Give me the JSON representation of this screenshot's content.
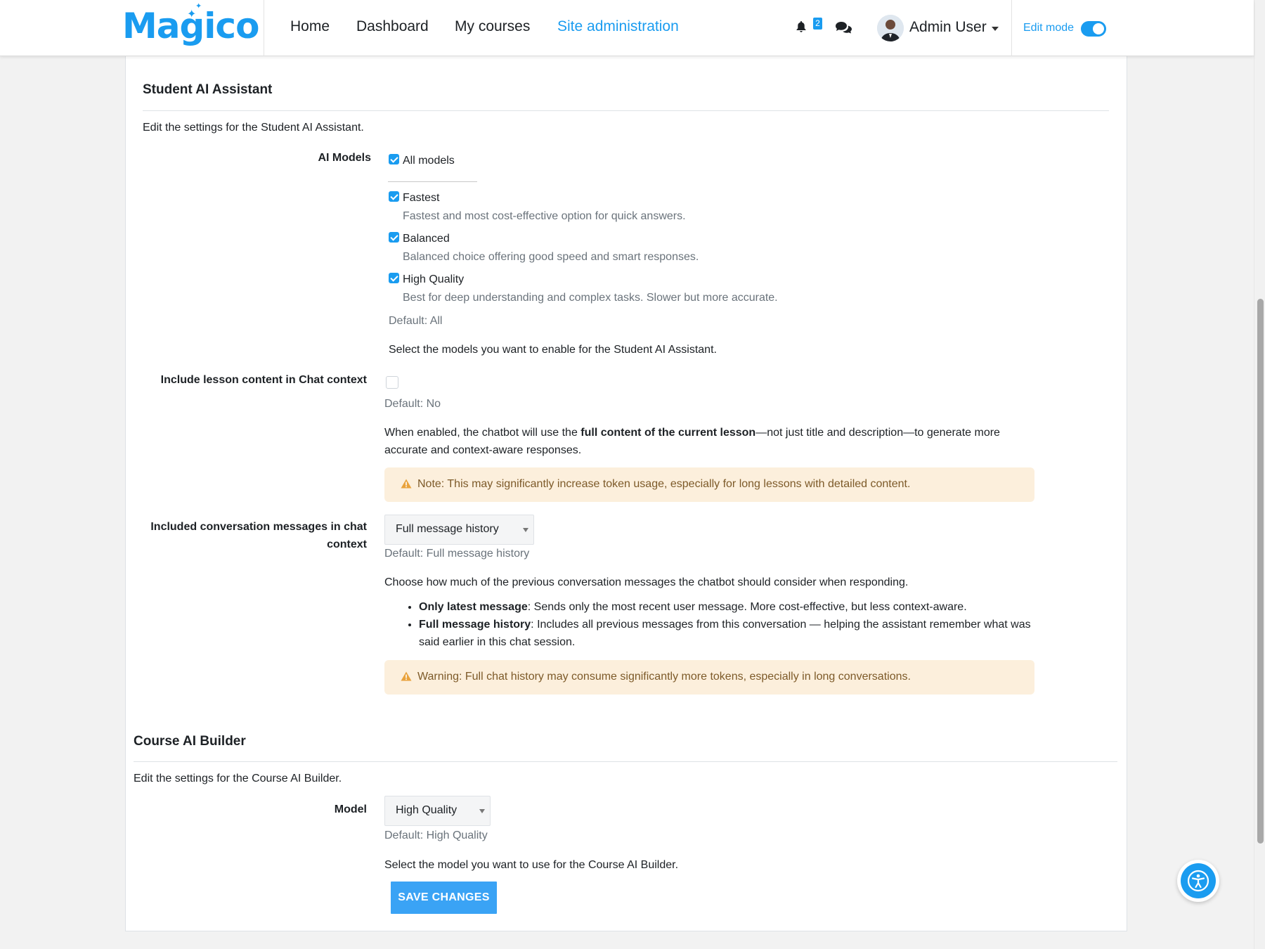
{
  "brand": {
    "name": "Magico"
  },
  "nav": {
    "links": [
      "Home",
      "Dashboard",
      "My courses",
      "Site administration"
    ],
    "notification_count": "2",
    "user_name": "Admin User",
    "edit_mode_label": "Edit mode",
    "edit_mode_on": true
  },
  "student_ai": {
    "title": "Student AI Assistant",
    "description": "Edit the settings for the Student AI Assistant.",
    "models_label": "AI Models",
    "all_models_label": "All models",
    "models": [
      {
        "name": "Fastest",
        "desc": "Fastest and most cost-effective option for quick answers.",
        "checked": true
      },
      {
        "name": "Balanced",
        "desc": "Balanced choice offering good speed and smart responses.",
        "checked": true
      },
      {
        "name": "High Quality",
        "desc": "Best for deep understanding and complex tasks. Slower but more accurate.",
        "checked": true
      }
    ],
    "models_default": "Default: All",
    "models_help": "Select the models you want to enable for the Student AI Assistant.",
    "lesson_label": "Include lesson content in Chat context",
    "lesson_default": "Default: No",
    "lesson_help_before": "When enabled, the chatbot will use the ",
    "lesson_help_bold": "full content of the current lesson",
    "lesson_help_after": "—not just title and description—to generate more accurate and context-aware responses.",
    "lesson_note": "Note: This may significantly increase token usage, especially for long lessons with detailed content.",
    "history_label_line1": "Included conversation messages in chat",
    "history_label_line2": "context",
    "history_value": "Full message history",
    "history_default": "Default: Full message history",
    "history_help": "Choose how much of the previous conversation messages the chatbot should consider when responding.",
    "history_options": [
      {
        "bold": "Only latest message",
        "text": ": Sends only the most recent user message. More cost-effective, but less context-aware."
      },
      {
        "bold": "Full message history",
        "text": ": Includes all previous messages from this conversation — helping the assistant remember what was said earlier in this chat session."
      }
    ],
    "history_warning": "Warning: Full chat history may consume significantly more tokens, especially in long conversations."
  },
  "course_ai": {
    "title": "Course AI Builder",
    "description": "Edit the settings for the Course AI Builder.",
    "model_label": "Model",
    "model_value": "High Quality",
    "model_default": "Default: High Quality",
    "model_help": "Select the model you want to use for the Course AI Builder."
  },
  "save_label": "SAVE CHANGES",
  "colors": {
    "accent": "#1a9cf0",
    "alert_bg": "#fcefdc",
    "alert_text": "#7d5a29"
  },
  "icons": [
    "bell-icon",
    "chat-icon",
    "caret-down-icon",
    "warning-icon",
    "accessibility-icon"
  ]
}
